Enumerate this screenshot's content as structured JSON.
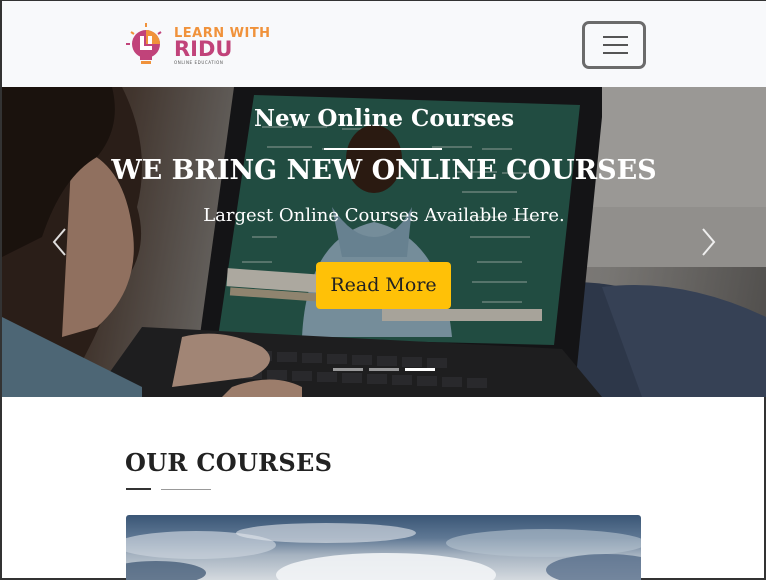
{
  "brand": {
    "line1": "LEARN WITH",
    "line2": "RIDU",
    "line3": "ONLINE EDUCATION",
    "colors": {
      "orange": "#f0923b",
      "magenta": "#c1437a"
    }
  },
  "navbar": {
    "toggler_icon": "hamburger-icon"
  },
  "hero": {
    "kicker": "New Online Courses",
    "title": "WE BRING NEW ONLINE COURSES",
    "subtitle": "Largest Online Courses Available Here.",
    "button_label": "Read More",
    "button_color": "#ffc107",
    "prev_icon": "chevron-left-icon",
    "next_icon": "chevron-right-icon",
    "slide_count": 3,
    "active_slide": 3
  },
  "courses": {
    "title": "OUR COURSES"
  }
}
